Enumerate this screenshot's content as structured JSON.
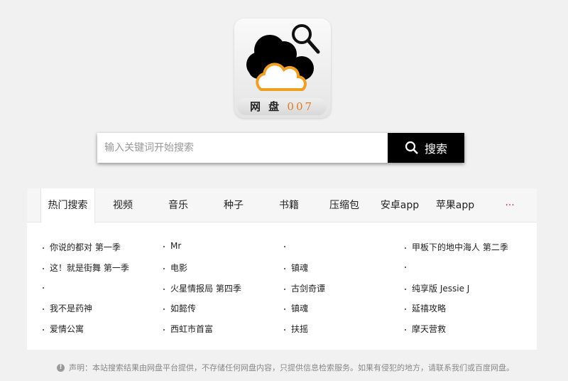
{
  "logo": {
    "text": "网 盘",
    "number": "007"
  },
  "search": {
    "placeholder": "输入关键词开始搜索",
    "button": "搜索"
  },
  "tabs": [
    "热门搜索",
    "视频",
    "音乐",
    "种子",
    "书籍",
    "压缩包",
    "安卓app",
    "苹果app",
    "···"
  ],
  "columns": [
    [
      "你说的都对 第一季",
      "这！就是街舞 第一季",
      "",
      "我不是药神",
      "爱情公寓"
    ],
    [
      "Mr",
      "电影",
      "火星情报局 第四季",
      "如懿传",
      "西虹市首富"
    ],
    [
      "",
      "镇魂",
      "古剑奇谭",
      "镇魂",
      "扶摇"
    ],
    [
      "甲板下的地中海人 第二季",
      "",
      "纯享版 Jessie J",
      "延禧攻略",
      "摩天营救"
    ]
  ],
  "notice": "声明：本站搜索结果由网盘平台提供，不存储任何网盘内容，只提供信息检索服务。如果有侵犯的地方，请联系我们或百度网盘。"
}
